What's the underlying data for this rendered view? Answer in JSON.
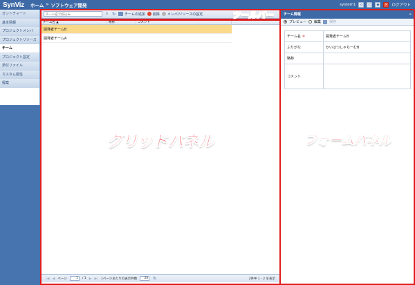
{
  "header": {
    "logo": "SynViz",
    "breadcrumb": [
      "ホーム",
      "ソフトウェア開発"
    ],
    "breadcrumb_sep": "»",
    "user": "system1",
    "logout": "ログアウト"
  },
  "sidebar": {
    "items": [
      {
        "label": "ガントチャート",
        "active": false
      },
      {
        "label": "基本情報",
        "active": false
      },
      {
        "label": "プロジェクトメンバ",
        "active": false
      },
      {
        "label": "プロジェクトリソース",
        "active": false
      },
      {
        "label": "チーム",
        "active": true
      },
      {
        "label": "プロジェクト設定",
        "active": false
      },
      {
        "label": "添付ファイル",
        "active": false
      },
      {
        "label": "カスタム属性",
        "active": false
      },
      {
        "label": "提案",
        "active": false
      }
    ]
  },
  "toolbar": {
    "search_placeholder": "チーム名で絞込み",
    "add_team": "チームの追加",
    "delete": "削除",
    "member_settings": "メンバ/リソースの設定",
    "annotation": "ツールバー"
  },
  "grid": {
    "columns": [
      "チーム名 ▲",
      "略称",
      "コメント"
    ],
    "rows": [
      {
        "name": "開発者チームB",
        "abbr": "",
        "comment": "",
        "selected": true
      },
      {
        "name": "開発者チームA",
        "abbr": "",
        "comment": "",
        "selected": false
      }
    ],
    "annotation": "グリッドパネル"
  },
  "pager": {
    "page_label": "ページ",
    "page_value": "1",
    "page_total": "/ 1",
    "per_page_label": "1ページあたりの表示件数",
    "per_page_value": "20",
    "summary": "2件中 1 - 2 を表示"
  },
  "form": {
    "title": "チーム情報",
    "collapse": "»",
    "mode_preview": "プレビュー",
    "mode_edit": "編集",
    "save": "保存",
    "fields": [
      {
        "label": "チーム名",
        "required_mark": "＊",
        "value": "開発者チームB"
      },
      {
        "label": "ふりがな",
        "required_mark": "",
        "value": "かいはつしゃちーむB"
      },
      {
        "label": "略称",
        "required_mark": "",
        "value": ""
      },
      {
        "label": "コメント",
        "required_mark": "",
        "value": ""
      }
    ],
    "annotation": "フォームパネル"
  }
}
